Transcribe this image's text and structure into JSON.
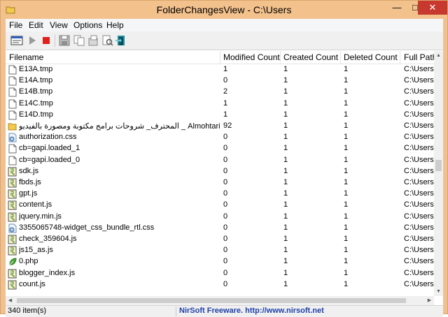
{
  "window": {
    "title": "FolderChangesView  -  C:\\Users",
    "minimize_glyph": "—",
    "maximize_glyph": "□",
    "close_glyph": "✕"
  },
  "menu": [
    "File",
    "Edit",
    "View",
    "Options",
    "Help"
  ],
  "toolbar": {
    "buttons": [
      "select-folder-icon",
      "start-icon",
      "stop-icon",
      "save-icon",
      "copy-icon",
      "properties-icon",
      "report-icon",
      "exit-icon"
    ]
  },
  "columns": [
    "Filename",
    "Modified Count",
    "Created Count",
    "Deleted Count",
    "Full Path"
  ],
  "rows": [
    {
      "filename": "E13A.tmp",
      "modified": "1",
      "created": "1",
      "deleted": "1",
      "path": "C:\\Users\\",
      "icon": "tmp-file-icon"
    },
    {
      "filename": "E14A.tmp",
      "modified": "0",
      "created": "1",
      "deleted": "1",
      "path": "C:\\Users\\",
      "icon": "tmp-file-icon"
    },
    {
      "filename": "E14B.tmp",
      "modified": "2",
      "created": "1",
      "deleted": "1",
      "path": "C:\\Users\\",
      "icon": "tmp-file-icon"
    },
    {
      "filename": "E14C.tmp",
      "modified": "1",
      "created": "1",
      "deleted": "1",
      "path": "C:\\Users\\",
      "icon": "tmp-file-icon"
    },
    {
      "filename": "E14D.tmp",
      "modified": "1",
      "created": "1",
      "deleted": "1",
      "path": "C:\\Users\\",
      "icon": "tmp-file-icon"
    },
    {
      "filename": "المحترف_ شروحات برامج مكتوبة ومصورة بالفيديو _ Almohtarif_files",
      "modified": "92",
      "created": "1",
      "deleted": "1",
      "path": "C:\\Users\\",
      "icon": "folder-icon"
    },
    {
      "filename": "authorization.css",
      "modified": "0",
      "created": "1",
      "deleted": "1",
      "path": "C:\\Users\\",
      "icon": "css-file-icon"
    },
    {
      "filename": "cb=gapi.loaded_1",
      "modified": "0",
      "created": "1",
      "deleted": "1",
      "path": "C:\\Users\\",
      "icon": "blank-file-icon"
    },
    {
      "filename": "cb=gapi.loaded_0",
      "modified": "0",
      "created": "1",
      "deleted": "1",
      "path": "C:\\Users\\",
      "icon": "blank-file-icon"
    },
    {
      "filename": "sdk.js",
      "modified": "0",
      "created": "1",
      "deleted": "1",
      "path": "C:\\Users\\",
      "icon": "js-file-icon"
    },
    {
      "filename": "fbds.js",
      "modified": "0",
      "created": "1",
      "deleted": "1",
      "path": "C:\\Users\\",
      "icon": "js-file-icon"
    },
    {
      "filename": "gpt.js",
      "modified": "0",
      "created": "1",
      "deleted": "1",
      "path": "C:\\Users\\",
      "icon": "js-file-icon"
    },
    {
      "filename": "content.js",
      "modified": "0",
      "created": "1",
      "deleted": "1",
      "path": "C:\\Users\\",
      "icon": "js-file-icon"
    },
    {
      "filename": "jquery.min.js",
      "modified": "0",
      "created": "1",
      "deleted": "1",
      "path": "C:\\Users\\",
      "icon": "js-file-icon"
    },
    {
      "filename": "3355065748-widget_css_bundle_rtl.css",
      "modified": "0",
      "created": "1",
      "deleted": "1",
      "path": "C:\\Users\\",
      "icon": "css-file-icon"
    },
    {
      "filename": "check_359604.js",
      "modified": "0",
      "created": "1",
      "deleted": "1",
      "path": "C:\\Users\\",
      "icon": "js-file-icon"
    },
    {
      "filename": "js15_as.js",
      "modified": "0",
      "created": "1",
      "deleted": "1",
      "path": "C:\\Users\\",
      "icon": "js-file-icon"
    },
    {
      "filename": "0.php",
      "modified": "0",
      "created": "1",
      "deleted": "1",
      "path": "C:\\Users\\",
      "icon": "php-file-icon"
    },
    {
      "filename": "blogger_index.js",
      "modified": "0",
      "created": "1",
      "deleted": "1",
      "path": "C:\\Users\\",
      "icon": "js-file-icon"
    },
    {
      "filename": "count.js",
      "modified": "0",
      "created": "1",
      "deleted": "1",
      "path": "C:\\Users\\",
      "icon": "js-file-icon"
    }
  ],
  "scrollbar": {
    "up_glyph": "▲",
    "down_glyph": "▼",
    "left_glyph": "◀",
    "right_glyph": "▶"
  },
  "status": {
    "count": "340 item(s)",
    "link": "NirSoft Freeware.  http://www.nirsoft.net"
  }
}
